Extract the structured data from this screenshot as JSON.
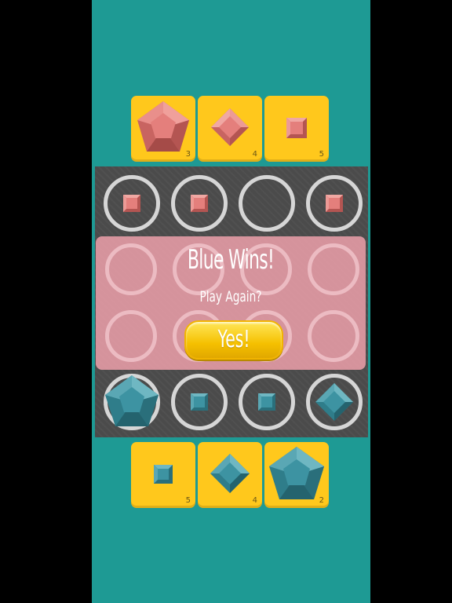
{
  "game": {
    "colors": {
      "background": "#1e9a94",
      "tray": "#ffc81c",
      "board": "#4b4b4b",
      "red_piece": "#e07c7b",
      "blue_piece": "#3d93a2",
      "overlay": "#eca0aa",
      "button": "#ffd21c"
    },
    "red_tray": [
      {
        "piece": "pentagon-icon",
        "count": "3"
      },
      {
        "piece": "diamond-icon",
        "count": "4"
      },
      {
        "piece": "square-icon",
        "count": "5"
      }
    ],
    "blue_tray": [
      {
        "piece": "square-icon",
        "count": "5"
      },
      {
        "piece": "diamond-icon",
        "count": "4"
      },
      {
        "piece": "pentagon-icon",
        "count": "2"
      }
    ],
    "board": {
      "top_row": [
        "red-square",
        "red-square",
        "empty",
        "red-square"
      ],
      "bottom_row": [
        "blue-pentagon",
        "blue-square",
        "blue-square",
        "blue-diamond"
      ]
    },
    "dialog": {
      "title": "Blue Wins!",
      "subtitle": "Play Again?",
      "button_label": "Yes!"
    }
  }
}
